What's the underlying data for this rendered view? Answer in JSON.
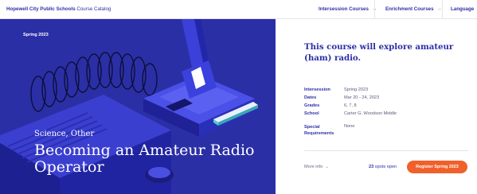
{
  "header": {
    "brand_bold": "Hopewell City Public Schools",
    "brand_rest": "Course Catalog",
    "nav": [
      {
        "label": "Intersession Courses",
        "arrow": "→"
      },
      {
        "label": "Enrichment Courses",
        "arrow": "→"
      },
      {
        "label": "Language"
      }
    ]
  },
  "hero": {
    "term": "Spring 2023",
    "category": "Science, Other",
    "title": "Becoming an Amateur Radio Operator"
  },
  "details": {
    "description": "This course will explore amateur (ham) radio.",
    "rows": [
      {
        "label": "Intersession",
        "value": "Spring 2023"
      },
      {
        "label": "Dates",
        "value": "Mar 20 - 24, 2023"
      },
      {
        "label": "Grades",
        "value": "6, 7, 8"
      },
      {
        "label": "School",
        "value": "Carter G. Woodson Middle"
      },
      {
        "label": "Special Requirements",
        "value": "None"
      }
    ],
    "more_info": "More info",
    "spots_count": "23",
    "spots_text": "spots open",
    "register_label": "Register Spring 2023"
  },
  "colors": {
    "brand_blue": "#2b2fa6",
    "accent_orange": "#f0602a"
  }
}
